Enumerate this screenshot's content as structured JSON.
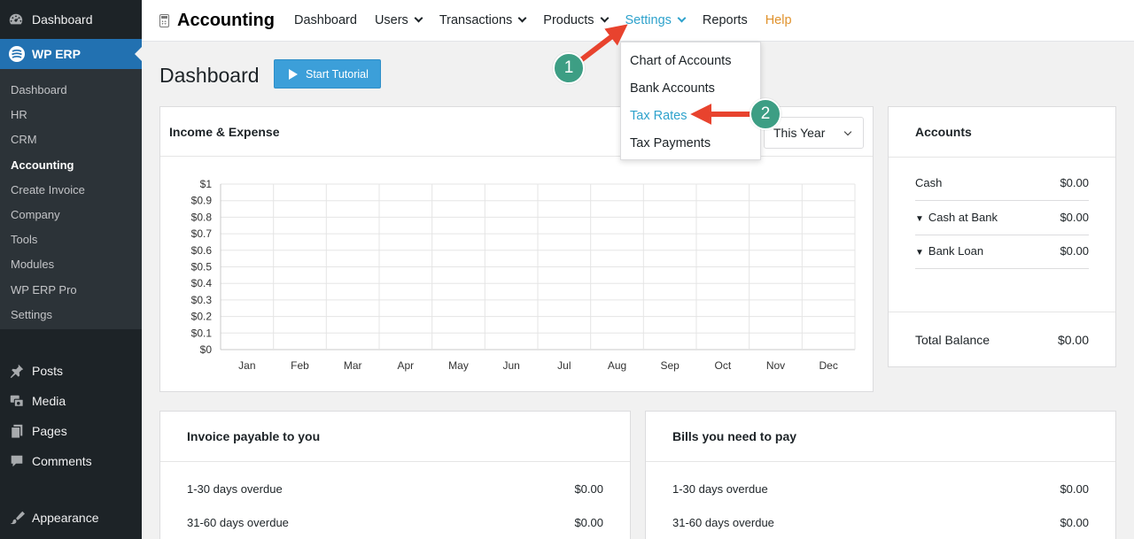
{
  "sidebar": {
    "top": {
      "label": "Dashboard",
      "icon": "dashboard-icon"
    },
    "active": {
      "label": "WP ERP",
      "icon": "wp-erp-icon"
    },
    "submenu": [
      {
        "label": "Dashboard"
      },
      {
        "label": "HR"
      },
      {
        "label": "CRM"
      },
      {
        "label": "Accounting",
        "current": true
      },
      {
        "label": "Create Invoice"
      },
      {
        "label": "Company"
      },
      {
        "label": "Tools"
      },
      {
        "label": "Modules"
      },
      {
        "label": "WP ERP Pro"
      },
      {
        "label": "Settings"
      }
    ],
    "main": [
      {
        "label": "Posts",
        "icon": "pin-icon"
      },
      {
        "label": "Media",
        "icon": "media-icon"
      },
      {
        "label": "Pages",
        "icon": "pages-icon"
      },
      {
        "label": "Comments",
        "icon": "comments-icon"
      },
      {
        "label": "Appearance",
        "icon": "paintbrush-icon"
      }
    ]
  },
  "topnav": {
    "title": "Accounting",
    "items": [
      {
        "label": "Dashboard",
        "dropdown": false
      },
      {
        "label": "Users",
        "dropdown": true
      },
      {
        "label": "Transactions",
        "dropdown": true
      },
      {
        "label": "Products",
        "dropdown": true
      },
      {
        "label": "Settings",
        "dropdown": true,
        "active": true
      },
      {
        "label": "Reports",
        "dropdown": false
      },
      {
        "label": "Help",
        "dropdown": false
      }
    ]
  },
  "settings_dropdown": {
    "items": [
      {
        "label": "Chart of Accounts"
      },
      {
        "label": "Bank Accounts"
      },
      {
        "label": "Tax Rates",
        "highlight": true
      },
      {
        "label": "Tax Payments"
      }
    ]
  },
  "page": {
    "title": "Dashboard",
    "tutorial_button": "Start Tutorial"
  },
  "income_panel": {
    "title": "Income & Expense",
    "period": "This Year"
  },
  "chart_data": {
    "type": "line",
    "title": "",
    "categories": [
      "Jan",
      "Feb",
      "Mar",
      "Apr",
      "May",
      "Jun",
      "Jul",
      "Aug",
      "Sep",
      "Oct",
      "Nov",
      "Dec"
    ],
    "yticks": [
      "$0",
      "$0.1",
      "$0.2",
      "$0.3",
      "$0.4",
      "$0.5",
      "$0.6",
      "$0.7",
      "$0.8",
      "$0.9",
      "$1"
    ],
    "ylim": [
      0,
      1
    ],
    "grid": true,
    "series": []
  },
  "accounts": {
    "title": "Accounts",
    "rows": [
      {
        "label": "Cash",
        "value": "$0.00",
        "caret": false
      },
      {
        "label": "Cash at Bank",
        "value": "$0.00",
        "caret": true
      },
      {
        "label": "Bank Loan",
        "value": "$0.00",
        "caret": true
      }
    ],
    "total_label": "Total Balance",
    "total_value": "$0.00"
  },
  "invoice_panel": {
    "title": "Invoice payable to you",
    "rows": [
      {
        "label": "1-30 days overdue",
        "value": "$0.00"
      },
      {
        "label": "31-60 days overdue",
        "value": "$0.00"
      }
    ]
  },
  "bills_panel": {
    "title": "Bills you need to pay",
    "rows": [
      {
        "label": "1-30 days overdue",
        "value": "$0.00"
      },
      {
        "label": "31-60 days overdue",
        "value": "$0.00"
      }
    ]
  },
  "annotations": {
    "steps": [
      "1",
      "2"
    ],
    "arrow_color": "#e8432e",
    "badge_color": "#3d9e84"
  }
}
